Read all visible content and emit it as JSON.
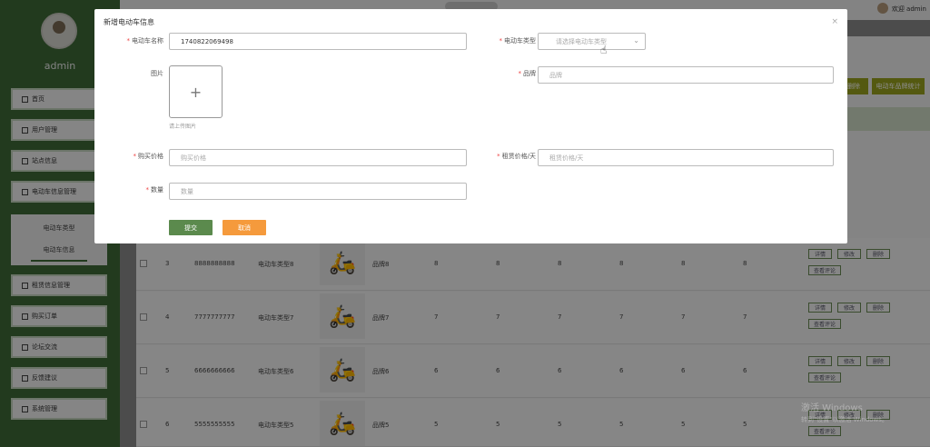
{
  "app": {
    "username": "admin",
    "welcome": "欢迎 admin",
    "top_buttons": [
      "删除",
      "电动车品牌统计"
    ]
  },
  "sidebar": {
    "items": [
      {
        "label": "首页",
        "icon": "home-icon"
      },
      {
        "label": "用户管理",
        "icon": "user-icon"
      },
      {
        "label": "站点信息",
        "icon": "grid-icon"
      },
      {
        "label": "电动车信息管理",
        "icon": "bike-icon"
      },
      {
        "label": "租赁信息管理",
        "icon": "grid-icon"
      },
      {
        "label": "购买订单",
        "icon": "order-icon"
      },
      {
        "label": "论坛交流",
        "icon": "chat-icon"
      },
      {
        "label": "反馈建议",
        "icon": "feedback-icon"
      },
      {
        "label": "系统管理",
        "icon": "settings-icon"
      }
    ],
    "submenu": [
      "电动车类型",
      "电动车信息"
    ]
  },
  "table": {
    "actions": [
      "详情",
      "修改",
      "删除",
      "查看评论"
    ],
    "rows": [
      {
        "id": "3",
        "name": "8888888888",
        "type": "电动车类型8",
        "brand": "品牌8",
        "vals": [
          "8",
          "8",
          "8",
          "8",
          "8",
          "8"
        ]
      },
      {
        "id": "4",
        "name": "7777777777",
        "type": "电动车类型7",
        "brand": "品牌7",
        "vals": [
          "7",
          "7",
          "7",
          "7",
          "7",
          "7"
        ]
      },
      {
        "id": "5",
        "name": "6666666666",
        "type": "电动车类型6",
        "brand": "品牌6",
        "vals": [
          "6",
          "6",
          "6",
          "6",
          "6",
          "6"
        ]
      },
      {
        "id": "6",
        "name": "5555555555",
        "type": "电动车类型5",
        "brand": "品牌5",
        "vals": [
          "5",
          "5",
          "5",
          "5",
          "5",
          "5"
        ]
      }
    ]
  },
  "dialog": {
    "title": "新增电动车信息",
    "close": "×",
    "fields": {
      "name_label": "电动车名称",
      "name_value": "1740822069498",
      "type_label": "电动车类型",
      "type_placeholder": "请选择电动车类型",
      "image_label": "图片",
      "image_hint": "请上传图片",
      "brand_label": "品牌",
      "brand_placeholder": "品牌",
      "price_label": "购买价格",
      "price_placeholder": "购买价格",
      "rent_label": "租赁价格/天",
      "rent_placeholder": "租赁价格/天",
      "qty_label": "数量",
      "qty_placeholder": "数量"
    },
    "submit": "提交",
    "cancel": "取消"
  },
  "watermark": [
    "激活 Windows",
    "转到\"设置\"以激活 Windows。"
  ]
}
